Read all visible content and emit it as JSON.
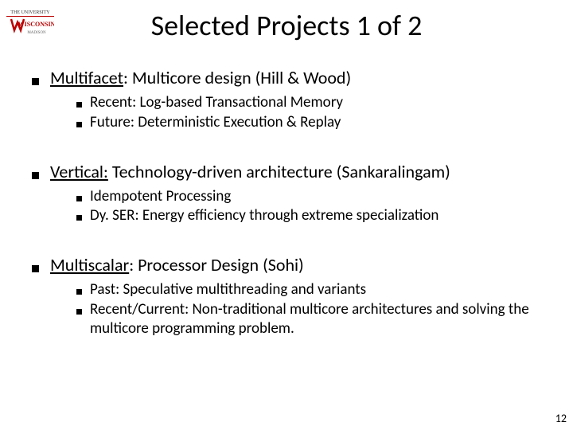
{
  "slide": {
    "title": "Selected Projects 1 of 2",
    "page_number": "12",
    "logo_alt": "wisconsin-logo"
  },
  "sections": [
    {
      "name_u": "Multifacet",
      "rest": ": Multicore design (Hill & Wood)",
      "items": [
        "Recent: Log-based Transactional Memory",
        "Future:  Deterministic Execution & Replay"
      ]
    },
    {
      "name_u": "Vertical:",
      "rest": " Technology-driven architecture (Sankaralingam)",
      "items": [
        "Idempotent Processing",
        "Dy. SER: Energy efficiency through extreme specialization"
      ]
    },
    {
      "name_u": "Multiscalar",
      "rest": ": Processor Design (Sohi)",
      "items": [
        "Past: Speculative multithreading and variants",
        "Recent/Current: Non-traditional multicore architectures and solving the  multicore programming problem."
      ]
    }
  ]
}
